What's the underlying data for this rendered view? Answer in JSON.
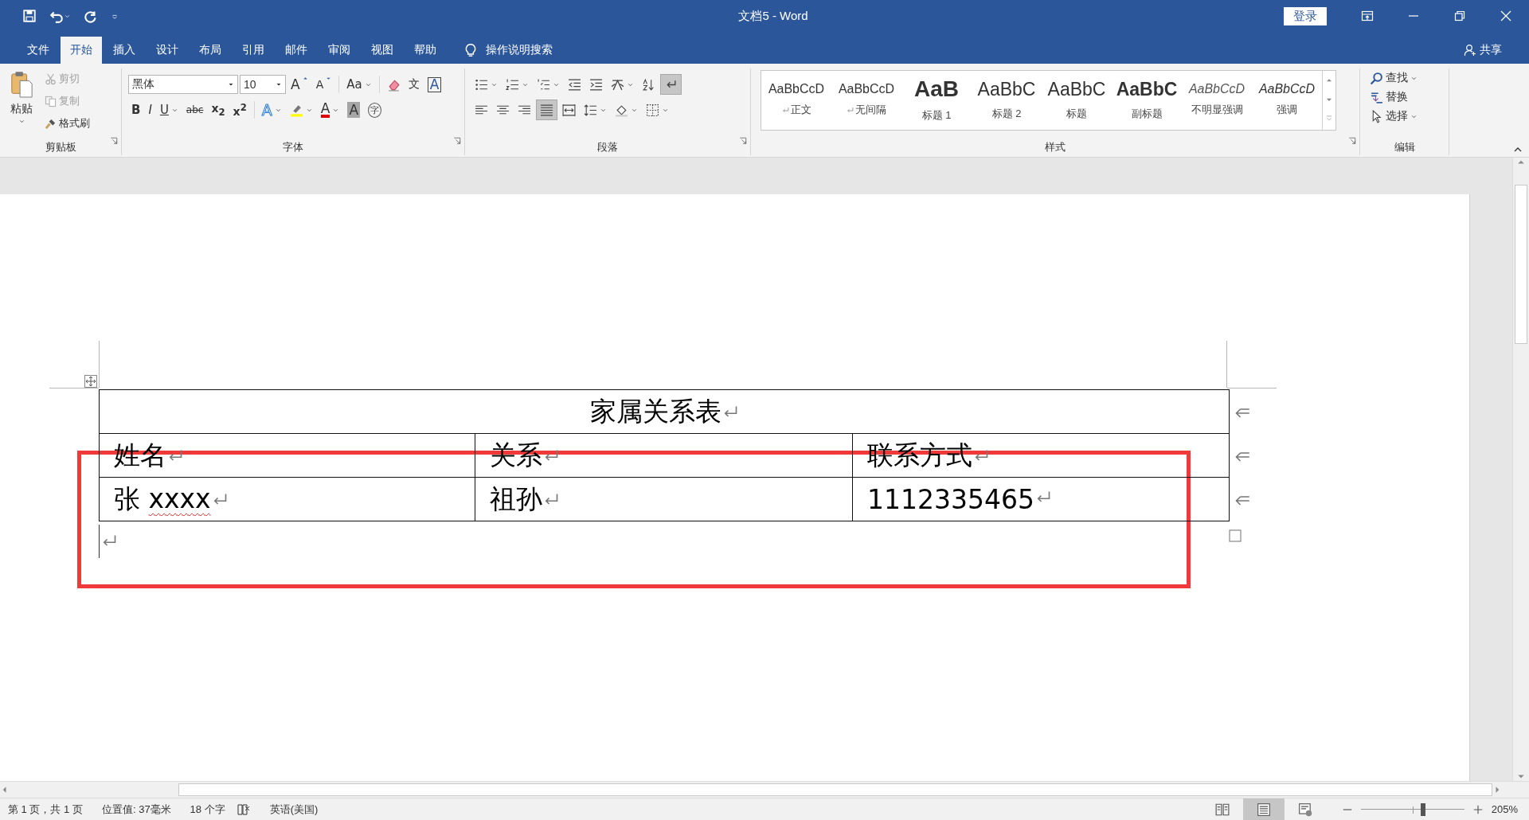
{
  "window": {
    "title": "文档5 - Word",
    "sign_in": "登录"
  },
  "tabs": [
    {
      "label": "文件",
      "selected": false
    },
    {
      "label": "开始",
      "selected": true
    },
    {
      "label": "插入",
      "selected": false
    },
    {
      "label": "设计",
      "selected": false
    },
    {
      "label": "布局",
      "selected": false
    },
    {
      "label": "引用",
      "selected": false
    },
    {
      "label": "邮件",
      "selected": false
    },
    {
      "label": "审阅",
      "selected": false
    },
    {
      "label": "视图",
      "selected": false
    },
    {
      "label": "帮助",
      "selected": false
    }
  ],
  "tell_me": "操作说明搜索",
  "share": "共享",
  "ribbon": {
    "clipboard": {
      "label": "剪贴板",
      "paste": "粘贴",
      "items": [
        {
          "kind": "cut",
          "label": "剪切",
          "disabled": true
        },
        {
          "kind": "copy",
          "label": "复制",
          "disabled": true
        },
        {
          "kind": "painter",
          "label": "格式刷",
          "disabled": false
        }
      ]
    },
    "font": {
      "label": "字体",
      "font_name": "黑体",
      "font_size": "10",
      "row_1": [
        {
          "kind": "grow",
          "glyph": "A",
          "dropdown": false
        },
        {
          "kind": "shrink",
          "glyph": "A",
          "dropdown": false
        },
        {
          "kind": "case",
          "glyph": "Aa",
          "dropdown": true
        },
        {
          "kind": "clear",
          "dropdown": false
        },
        {
          "kind": "phonetic",
          "glyph": "文",
          "dropdown": false
        },
        {
          "kind": "border",
          "glyph": "A",
          "dropdown": false
        }
      ],
      "row_2": [
        {
          "kind": "bold",
          "glyph": "B",
          "dropdown": false
        },
        {
          "kind": "italic",
          "glyph": "I",
          "dropdown": false
        },
        {
          "kind": "underline",
          "glyph": "U",
          "dropdown": true
        },
        {
          "kind": "strike",
          "glyph": "abc",
          "dropdown": false
        },
        {
          "kind": "plain",
          "glyph": "x$_{2}$",
          "dropdown": false
        },
        {
          "kind": "plain",
          "glyph": "x$^{2}$",
          "dropdown": false
        },
        {
          "kind": "effects",
          "glyph": "A",
          "dropdown": true
        },
        {
          "kind": "highlight",
          "dropdown": true
        },
        {
          "kind": "color",
          "glyph": "A",
          "dropdown": true
        },
        {
          "kind": "shading",
          "glyph": "A",
          "dropdown": false
        },
        {
          "kind": "enclose",
          "glyph": "字",
          "dropdown": false
        }
      ]
    },
    "paragraph": {
      "label": "段落",
      "row_1": [
        {
          "kind": "bullets",
          "dropdown": true,
          "selected": false
        },
        {
          "kind": "numbering",
          "dropdown": true,
          "selected": false
        },
        {
          "kind": "multilevel",
          "dropdown": true,
          "selected": false
        },
        {
          "kind": "outdent",
          "dropdown": false,
          "selected": false
        },
        {
          "kind": "indent",
          "dropdown": false,
          "selected": false
        },
        {
          "kind": "asian",
          "dropdown": true,
          "selected": false
        },
        {
          "kind": "sort",
          "dropdown": false,
          "selected": false
        },
        {
          "kind": "marks",
          "dropdown": false,
          "selected": true
        }
      ],
      "row_2": [
        {
          "kind": "left",
          "dropdown": false,
          "selected": false
        },
        {
          "kind": "center",
          "dropdown": false,
          "selected": false
        },
        {
          "kind": "right",
          "dropdown": false,
          "selected": false
        },
        {
          "kind": "justify",
          "dropdown": false,
          "selected": true
        },
        {
          "kind": "distribute",
          "dropdown": false,
          "selected": false
        },
        {
          "kind": "spacing",
          "dropdown": true,
          "selected": false
        },
        {
          "kind": "fill",
          "dropdown": true,
          "selected": false
        },
        {
          "kind": "borders",
          "dropdown": true,
          "selected": false
        }
      ]
    },
    "styles": {
      "label": "样式",
      "items": [
        {
          "preview": "AaBbCcD",
          "name": "正文",
          "kind": "normal",
          "paragraph_mark": true
        },
        {
          "preview": "AaBbCcD",
          "name": "无间隔",
          "kind": "normal",
          "paragraph_mark": true
        },
        {
          "preview": "AaB",
          "name": "标题 1",
          "kind": "heading1",
          "paragraph_mark": false
        },
        {
          "preview": "AaBbC",
          "name": "标题 2",
          "kind": "heading2",
          "paragraph_mark": false
        },
        {
          "preview": "AaBbC",
          "name": "标题",
          "kind": "title",
          "paragraph_mark": false
        },
        {
          "preview": "AaBbC",
          "name": "副标题",
          "kind": "subtitle",
          "paragraph_mark": false
        },
        {
          "preview": "AaBbCcD",
          "name": "不明显强调",
          "kind": "subtle",
          "paragraph_mark": false
        },
        {
          "preview": "AaBbCcD",
          "name": "强调",
          "kind": "emphasis",
          "paragraph_mark": false
        }
      ]
    },
    "editing": {
      "label": "编辑",
      "items": [
        {
          "kind": "find",
          "label": "查找",
          "dropdown": true
        },
        {
          "kind": "replace",
          "label": "替换",
          "dropdown": false
        },
        {
          "kind": "select",
          "label": "选择",
          "dropdown": true
        }
      ]
    }
  },
  "document": {
    "table": {
      "title": "家属关系表",
      "header": [
        "姓名",
        "关系",
        "联系方式"
      ],
      "rows": [
        [
          {
            "parts": [
              {
                "text": "张 ",
                "misspelled": false
              },
              {
                "text": "xxxx",
                "misspelled": true
              }
            ]
          },
          {
            "parts": [
              {
                "text": "祖孙",
                "misspelled": false
              }
            ]
          },
          {
            "parts": [
              {
                "text": "1112335465",
                "misspelled": false
              }
            ]
          }
        ]
      ]
    }
  },
  "status_bar": {
    "items": [
      "第 1 页，共 1 页",
      "位置值: 37毫米",
      "18 个字",
      "英语(美国)"
    ],
    "views": [
      {
        "kind": "read",
        "selected": false
      },
      {
        "kind": "print",
        "selected": true
      },
      {
        "kind": "web",
        "selected": false
      }
    ],
    "zoom": {
      "level": 0.6,
      "reading": "205%"
    }
  }
}
